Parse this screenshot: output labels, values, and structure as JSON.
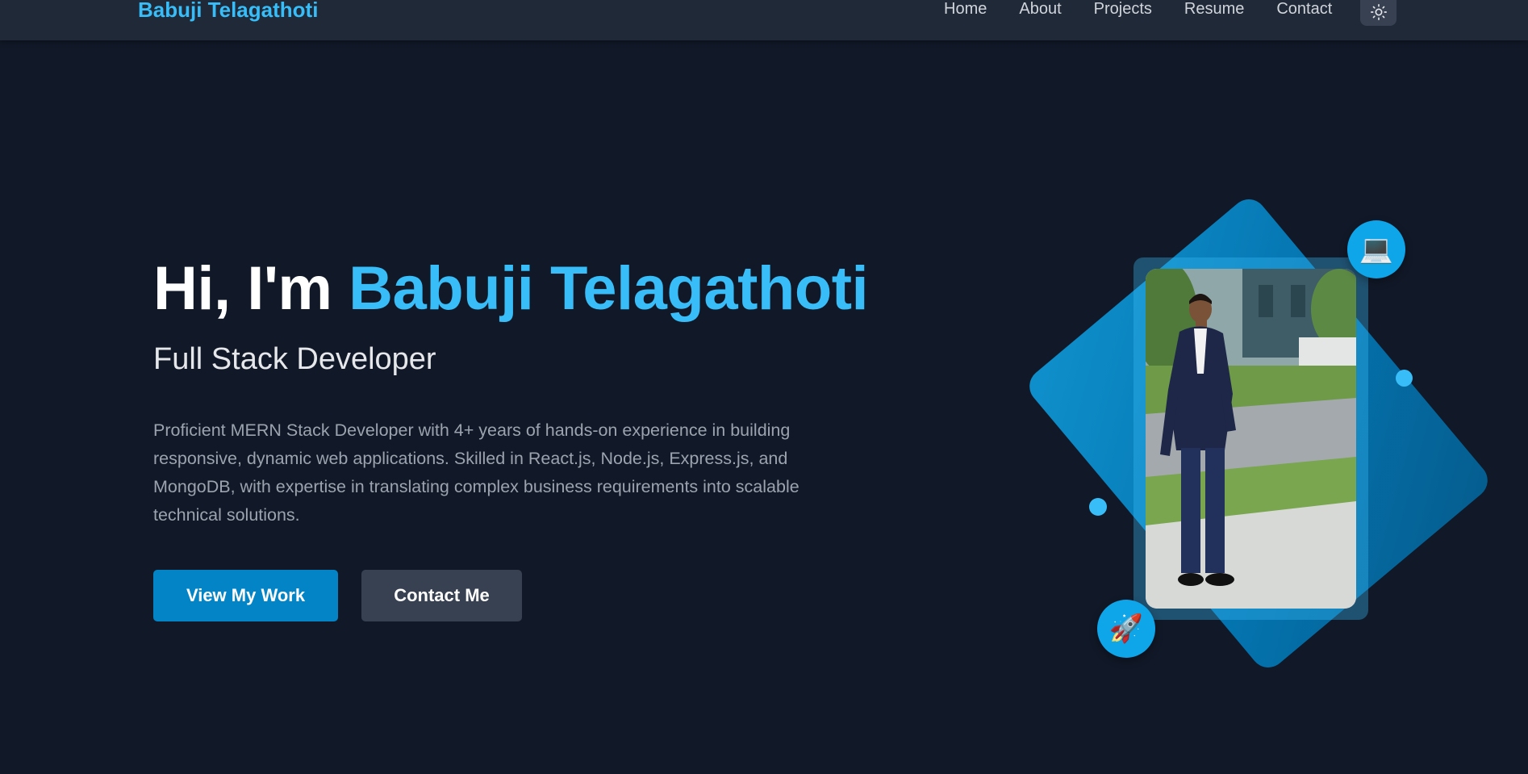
{
  "nav": {
    "brand": "Babuji Telagathoti",
    "links": [
      "Home",
      "About",
      "Projects",
      "Resume",
      "Contact"
    ],
    "theme_toggle_icon": "sun-icon"
  },
  "hero": {
    "greeting": "Hi, I'm ",
    "name": "Babuji Telagathoti",
    "subtitle": "Full Stack Developer",
    "description": "Proficient MERN Stack Developer with 4+ years of hands-on experience in building responsive, dynamic web applications. Skilled in React.js, Node.js, Express.js, and MongoDB, with expertise in translating complex business requirements into scalable technical solutions.",
    "primary_button": "View My Work",
    "secondary_button": "Contact Me"
  },
  "illustration": {
    "top_badge_icon": "💻",
    "bottom_badge_icon": "🚀"
  },
  "colors": {
    "background": "#111827",
    "navbar": "#1f2937",
    "accent": "#38bdf8",
    "primary_button": "#0284c7",
    "secondary_button": "#374151"
  }
}
